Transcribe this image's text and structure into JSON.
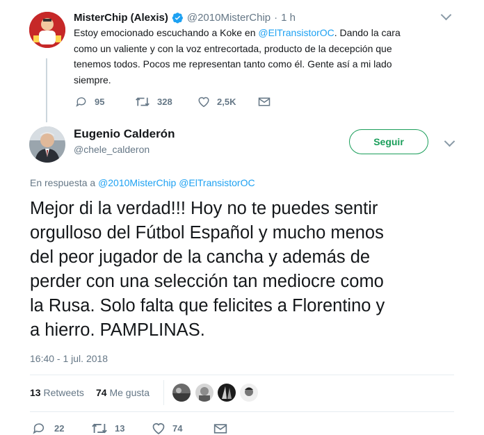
{
  "quoted_tweet": {
    "display_name": "MisterChip (Alexis)",
    "handle": "@2010MisterChip",
    "separator": "·",
    "time": "1 h",
    "text_before": "Estoy emocionado escuchando a Koke en ",
    "mention": "@ElTransistorOC",
    "text_after": ". Dando la cara",
    "line2": "como un valiente y con la voz entrecortada, producto de la decepción que",
    "line3": "tenemos todos. Pocos me representan tanto como él. Gente así a mi lado",
    "line4": "siempre.",
    "replies": "95",
    "retweets": "328",
    "likes": "2,5K"
  },
  "main_tweet": {
    "display_name": "Eugenio Calderón",
    "handle": "@chele_calderon",
    "follow_label": "Seguir",
    "reply_prefix": "En respuesta a ",
    "reply_to": "@2010MisterChip @ElTransistorOC",
    "lines": [
      "Mejor di la verdad!!! Hoy no te puedes sentir",
      "orgulloso del Fútbol Español y mucho menos",
      "del peor jugador de la cancha y además de",
      "perder con una selección tan mediocre como",
      "la Rusa. Solo falta que felicites a Florentino y",
      "a hierro. PAMPLINAS."
    ],
    "timestamp": "16:40 - 1 jul. 2018",
    "retweet_count": "13",
    "retweet_label": "Retweets",
    "like_count": "74",
    "like_label": "Me gusta",
    "replies": "22",
    "retweets": "13",
    "likes": "74"
  },
  "colors": {
    "link": "#1da1f2",
    "verified": "#1da1f2",
    "follow": "#1a9e5a",
    "muted": "#657786"
  }
}
